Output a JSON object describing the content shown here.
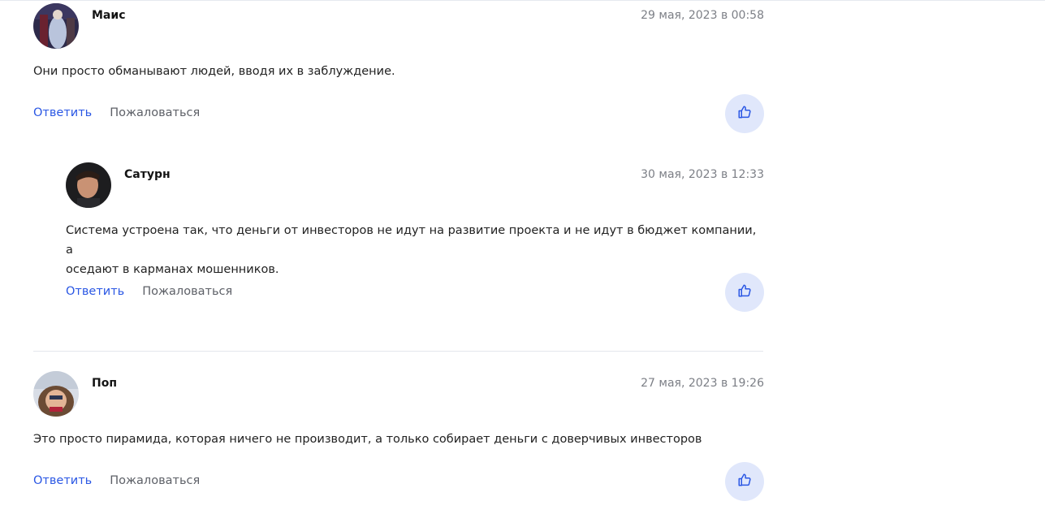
{
  "comments": [
    {
      "author": "Маис",
      "date": "29 мая, 2023 в 00:58",
      "text": "Они просто обманывают людей, вводя их в заблуждение.",
      "reply_label": "Ответить",
      "complain_label": "Пожаловаться",
      "like_icon": "thumbs-up-icon",
      "avatar": "user-avatar-photo"
    },
    {
      "author": "Сатурн",
      "date": "30 мая, 2023 в 12:33",
      "text_lines": [
        "Система устроена так, что деньги от инвесторов не идут на развитие проекта и не идут в бюджет компании, а",
        "оседают в карманах мошенников."
      ],
      "reply_label": "Ответить",
      "complain_label": "Пожаловаться",
      "like_icon": "thumbs-up-icon",
      "avatar": "user-avatar-photo"
    },
    {
      "author": "Поп",
      "date": "27 мая, 2023 в 19:26",
      "text": "Это просто пирамида, которая ничего не производит, а только собирает деньги с доверчивых инвесторов",
      "reply_label": "Ответить",
      "complain_label": "Пожаловаться",
      "like_icon": "thumbs-up-icon",
      "avatar": "user-avatar-photo"
    }
  ],
  "colors": {
    "link": "#2a57e4",
    "secondary_text": "#5d6067",
    "date_text": "#7c7f86",
    "like_button_bg": "#e0e7fb",
    "like_icon": "#2a57e4"
  }
}
